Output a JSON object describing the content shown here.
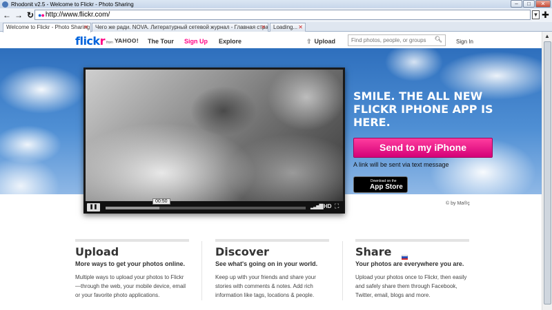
{
  "browser": {
    "window_title": "Rhodonit v2.5 - Welcome to Flickr - Photo Sharing",
    "url": "http://www.flickr.com/",
    "tabs": [
      {
        "label": "Welcome to Flickr - Photo Sharing"
      },
      {
        "label": "Чего же ради. NOVA. Литературный сетевой журнал - Главная страница."
      },
      {
        "label": "Loading..."
      }
    ]
  },
  "header": {
    "logo_text_1": "flick",
    "logo_text_2": "r",
    "logo_from": "from",
    "logo_yahoo": "YAHOO!",
    "nav": {
      "tour": "The Tour",
      "signup": "Sign Up",
      "explore": "Explore"
    },
    "upload": "Upload",
    "search_placeholder": "Find photos, people, or groups",
    "signin": "Sign In"
  },
  "hero": {
    "headline": "Smile. The all new Flickr iPhone app is here.",
    "send_button": "Send to my iPhone",
    "link_note": "A link will be sent via text message",
    "appstore_small": "Download on the",
    "appstore_big": "App Store",
    "video": {
      "time": "00:50",
      "progress": 0.27,
      "hd": "HD"
    },
    "credit": "© by Ma®ç"
  },
  "columns": [
    {
      "title": "Upload",
      "subtitle": "More ways to get your photos online.",
      "body": "Multiple ways to upload your photos to Flickr—through the web, your mobile device, email or your favorite photo applications."
    },
    {
      "title": "Discover",
      "subtitle": "See what's going on in your world.",
      "body": "Keep up with your friends and share your stories with comments & notes. Add rich information like tags, locations & people."
    },
    {
      "title": "Share",
      "subtitle": "Your photos are everywhere you are.",
      "body": "Upload your photos once to Flickr, then easily and safely share them through Facebook, Twitter, email, blogs and more."
    }
  ],
  "colors": {
    "flickr_blue": "#0063dc",
    "flickr_pink": "#ff0084"
  }
}
